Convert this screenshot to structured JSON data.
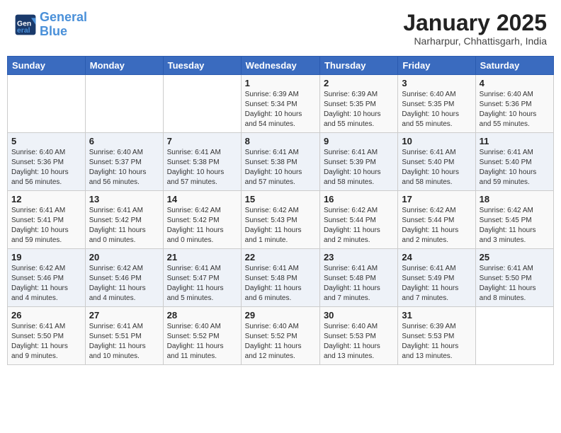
{
  "header": {
    "logo_line1": "General",
    "logo_line2": "Blue",
    "month": "January 2025",
    "location": "Narharpur, Chhattisgarh, India"
  },
  "days_of_week": [
    "Sunday",
    "Monday",
    "Tuesday",
    "Wednesday",
    "Thursday",
    "Friday",
    "Saturday"
  ],
  "weeks": [
    [
      {
        "day": "",
        "info": ""
      },
      {
        "day": "",
        "info": ""
      },
      {
        "day": "",
        "info": ""
      },
      {
        "day": "1",
        "info": "Sunrise: 6:39 AM\nSunset: 5:34 PM\nDaylight: 10 hours\nand 54 minutes."
      },
      {
        "day": "2",
        "info": "Sunrise: 6:39 AM\nSunset: 5:35 PM\nDaylight: 10 hours\nand 55 minutes."
      },
      {
        "day": "3",
        "info": "Sunrise: 6:40 AM\nSunset: 5:35 PM\nDaylight: 10 hours\nand 55 minutes."
      },
      {
        "day": "4",
        "info": "Sunrise: 6:40 AM\nSunset: 5:36 PM\nDaylight: 10 hours\nand 55 minutes."
      }
    ],
    [
      {
        "day": "5",
        "info": "Sunrise: 6:40 AM\nSunset: 5:36 PM\nDaylight: 10 hours\nand 56 minutes."
      },
      {
        "day": "6",
        "info": "Sunrise: 6:40 AM\nSunset: 5:37 PM\nDaylight: 10 hours\nand 56 minutes."
      },
      {
        "day": "7",
        "info": "Sunrise: 6:41 AM\nSunset: 5:38 PM\nDaylight: 10 hours\nand 57 minutes."
      },
      {
        "day": "8",
        "info": "Sunrise: 6:41 AM\nSunset: 5:38 PM\nDaylight: 10 hours\nand 57 minutes."
      },
      {
        "day": "9",
        "info": "Sunrise: 6:41 AM\nSunset: 5:39 PM\nDaylight: 10 hours\nand 58 minutes."
      },
      {
        "day": "10",
        "info": "Sunrise: 6:41 AM\nSunset: 5:40 PM\nDaylight: 10 hours\nand 58 minutes."
      },
      {
        "day": "11",
        "info": "Sunrise: 6:41 AM\nSunset: 5:40 PM\nDaylight: 10 hours\nand 59 minutes."
      }
    ],
    [
      {
        "day": "12",
        "info": "Sunrise: 6:41 AM\nSunset: 5:41 PM\nDaylight: 10 hours\nand 59 minutes."
      },
      {
        "day": "13",
        "info": "Sunrise: 6:41 AM\nSunset: 5:42 PM\nDaylight: 11 hours\nand 0 minutes."
      },
      {
        "day": "14",
        "info": "Sunrise: 6:42 AM\nSunset: 5:42 PM\nDaylight: 11 hours\nand 0 minutes."
      },
      {
        "day": "15",
        "info": "Sunrise: 6:42 AM\nSunset: 5:43 PM\nDaylight: 11 hours\nand 1 minute."
      },
      {
        "day": "16",
        "info": "Sunrise: 6:42 AM\nSunset: 5:44 PM\nDaylight: 11 hours\nand 2 minutes."
      },
      {
        "day": "17",
        "info": "Sunrise: 6:42 AM\nSunset: 5:44 PM\nDaylight: 11 hours\nand 2 minutes."
      },
      {
        "day": "18",
        "info": "Sunrise: 6:42 AM\nSunset: 5:45 PM\nDaylight: 11 hours\nand 3 minutes."
      }
    ],
    [
      {
        "day": "19",
        "info": "Sunrise: 6:42 AM\nSunset: 5:46 PM\nDaylight: 11 hours\nand 4 minutes."
      },
      {
        "day": "20",
        "info": "Sunrise: 6:42 AM\nSunset: 5:46 PM\nDaylight: 11 hours\nand 4 minutes."
      },
      {
        "day": "21",
        "info": "Sunrise: 6:41 AM\nSunset: 5:47 PM\nDaylight: 11 hours\nand 5 minutes."
      },
      {
        "day": "22",
        "info": "Sunrise: 6:41 AM\nSunset: 5:48 PM\nDaylight: 11 hours\nand 6 minutes."
      },
      {
        "day": "23",
        "info": "Sunrise: 6:41 AM\nSunset: 5:48 PM\nDaylight: 11 hours\nand 7 minutes."
      },
      {
        "day": "24",
        "info": "Sunrise: 6:41 AM\nSunset: 5:49 PM\nDaylight: 11 hours\nand 7 minutes."
      },
      {
        "day": "25",
        "info": "Sunrise: 6:41 AM\nSunset: 5:50 PM\nDaylight: 11 hours\nand 8 minutes."
      }
    ],
    [
      {
        "day": "26",
        "info": "Sunrise: 6:41 AM\nSunset: 5:50 PM\nDaylight: 11 hours\nand 9 minutes."
      },
      {
        "day": "27",
        "info": "Sunrise: 6:41 AM\nSunset: 5:51 PM\nDaylight: 11 hours\nand 10 minutes."
      },
      {
        "day": "28",
        "info": "Sunrise: 6:40 AM\nSunset: 5:52 PM\nDaylight: 11 hours\nand 11 minutes."
      },
      {
        "day": "29",
        "info": "Sunrise: 6:40 AM\nSunset: 5:52 PM\nDaylight: 11 hours\nand 12 minutes."
      },
      {
        "day": "30",
        "info": "Sunrise: 6:40 AM\nSunset: 5:53 PM\nDaylight: 11 hours\nand 13 minutes."
      },
      {
        "day": "31",
        "info": "Sunrise: 6:39 AM\nSunset: 5:53 PM\nDaylight: 11 hours\nand 13 minutes."
      },
      {
        "day": "",
        "info": ""
      }
    ]
  ]
}
